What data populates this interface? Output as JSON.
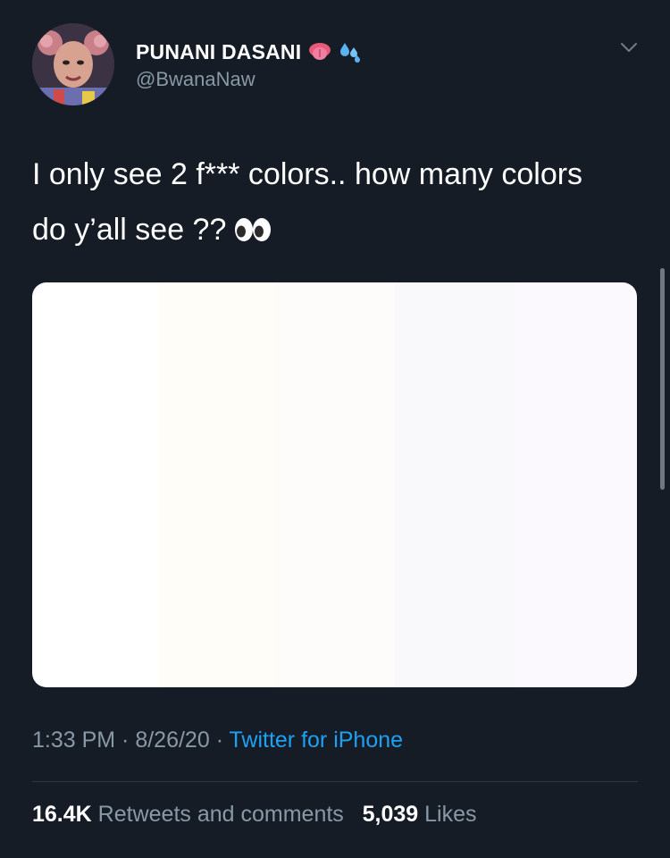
{
  "user": {
    "display_name": "PUNANI DASANI",
    "handle": "@BwanaNaw",
    "name_emojis": [
      "tongue-emoji",
      "sweat-droplets-emoji"
    ]
  },
  "tweet": {
    "text": "I only see 2 f*** colors.. how many colors do y’all see ??",
    "trailing_emoji": "eyes-emoji"
  },
  "media": {
    "description_colors": [
      "#ffffff",
      "#fefdf8",
      "#fdfcfb",
      "#f9f9fc",
      "#fbf9fd"
    ]
  },
  "meta": {
    "time": "1:33 PM",
    "separator": " · ",
    "date": "8/26/20",
    "source": "Twitter for iPhone"
  },
  "stats": {
    "retweets_count": "16.4K",
    "retweets_label": "Retweets and comments",
    "likes_count": "5,039",
    "likes_label": "Likes"
  },
  "colors": {
    "background": "#151c26",
    "secondary_text": "#8899a6",
    "link": "#1da1f2"
  }
}
